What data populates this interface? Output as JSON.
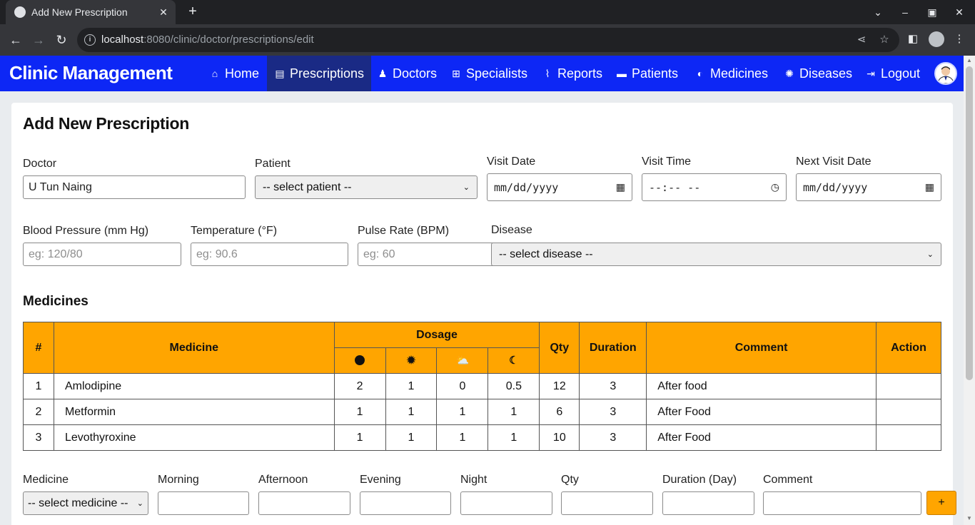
{
  "browser": {
    "tab_title": "Add New Prescription",
    "url_host": "localhost",
    "url_rest": ":8080/clinic/doctor/prescriptions/edit"
  },
  "app": {
    "brand": "Clinic Management",
    "nav": [
      {
        "label": "Home",
        "icon": "home-icon"
      },
      {
        "label": "Prescriptions",
        "icon": "prescription-icon",
        "active": true
      },
      {
        "label": "Doctors",
        "icon": "doctor-icon"
      },
      {
        "label": "Specialists",
        "icon": "briefcase-medical-icon"
      },
      {
        "label": "Reports",
        "icon": "chart-line-icon"
      },
      {
        "label": "Patients",
        "icon": "bed-icon"
      },
      {
        "label": "Medicines",
        "icon": "pills-icon"
      },
      {
        "label": "Diseases",
        "icon": "virus-icon"
      },
      {
        "label": "Logout",
        "icon": "logout-icon"
      }
    ],
    "accent_color": "#0d27f5",
    "table_header_color": "#ffa500"
  },
  "form": {
    "title": "Add New Prescription",
    "doctor_label": "Doctor",
    "doctor_value": "U Tun Naing",
    "patient_label": "Patient",
    "patient_selected": "-- select patient --",
    "visit_date_label": "Visit Date",
    "visit_date_placeholder": "mm/dd/yyyy",
    "visit_time_label": "Visit Time",
    "visit_time_placeholder": "--:-- --",
    "next_visit_label": "Next Visit Date",
    "next_visit_placeholder": "mm/dd/yyyy",
    "bp_label": "Blood Pressure (mm Hg)",
    "bp_placeholder": "eg: 120/80",
    "temp_label": "Temperature (°F)",
    "temp_placeholder": "eg: 90.6",
    "pulse_label": "Pulse Rate (BPM)",
    "pulse_placeholder": "eg: 60",
    "disease_label": "Disease",
    "disease_selected": "-- select disease --"
  },
  "medicines": {
    "title": "Medicines",
    "headers": {
      "num": "#",
      "medicine": "Medicine",
      "dosage": "Dosage",
      "qty": "Qty",
      "duration": "Duration",
      "comment": "Comment",
      "action": "Action"
    },
    "dosage_icons": [
      "morning-circle-icon",
      "sun-icon",
      "cloud-sun-icon",
      "moon-icon"
    ],
    "rows": [
      {
        "num": "1",
        "medicine": "Amlodipine",
        "morning": "2",
        "afternoon": "1",
        "evening": "0",
        "night": "0.5",
        "qty": "12",
        "duration": "3",
        "comment": "After food"
      },
      {
        "num": "2",
        "medicine": "Metformin",
        "morning": "1",
        "afternoon": "1",
        "evening": "1",
        "night": "1",
        "qty": "6",
        "duration": "3",
        "comment": "After Food"
      },
      {
        "num": "3",
        "medicine": "Levothyroxine",
        "morning": "1",
        "afternoon": "1",
        "evening": "1",
        "night": "1",
        "qty": "10",
        "duration": "3",
        "comment": "After Food"
      }
    ]
  },
  "add_row": {
    "medicine_label": "Medicine",
    "medicine_selected": "-- select medicine --",
    "morning_label": "Morning",
    "afternoon_label": "Afternoon",
    "evening_label": "Evening",
    "night_label": "Night",
    "qty_label": "Qty",
    "duration_label": "Duration (Day)",
    "comment_label": "Comment",
    "add_button": "+"
  }
}
